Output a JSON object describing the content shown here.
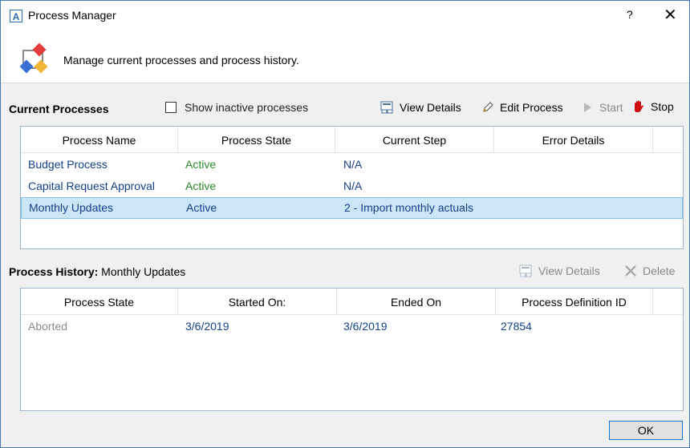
{
  "window": {
    "title": "Process Manager",
    "app_icon_letter": "A",
    "help": "?",
    "close": "✕"
  },
  "header": {
    "description": "Manage current processes and process history."
  },
  "current": {
    "label": "Current Processes",
    "show_inactive_label": "Show inactive processes",
    "show_inactive_checked": false,
    "toolbar": {
      "view_details": "View Details",
      "edit_process": "Edit Process",
      "start": "Start",
      "stop": "Stop"
    },
    "columns": [
      "Process Name",
      "Process State",
      "Current Step",
      "Error Details"
    ],
    "rows": [
      {
        "name": "Budget Process",
        "state": "Active",
        "step": "N/A",
        "error": ""
      },
      {
        "name": "Capital Request Approval",
        "state": "Active",
        "step": "N/A",
        "error": ""
      },
      {
        "name": "Monthly Updates",
        "state": "Active",
        "step": "2 - Import monthly actuals",
        "error": ""
      }
    ],
    "selected_row": 2
  },
  "history": {
    "label_bold": "Process History:",
    "label_name": "Monthly Updates",
    "toolbar": {
      "view_details": "View Details",
      "delete": "Delete"
    },
    "columns": [
      "Process State",
      "Started On:",
      "Ended On",
      "Process Definition ID"
    ],
    "rows": [
      {
        "state": "Aborted",
        "started": "3/6/2019",
        "ended": "3/6/2019",
        "definition_id": "27854"
      }
    ]
  },
  "footer": {
    "ok_label": "OK"
  },
  "colors": {
    "accent": "#0a78d7",
    "active_green": "#2c8a2c",
    "link_blue": "#14408a",
    "selection": "#cde6f7",
    "stop_red": "#d01010"
  }
}
